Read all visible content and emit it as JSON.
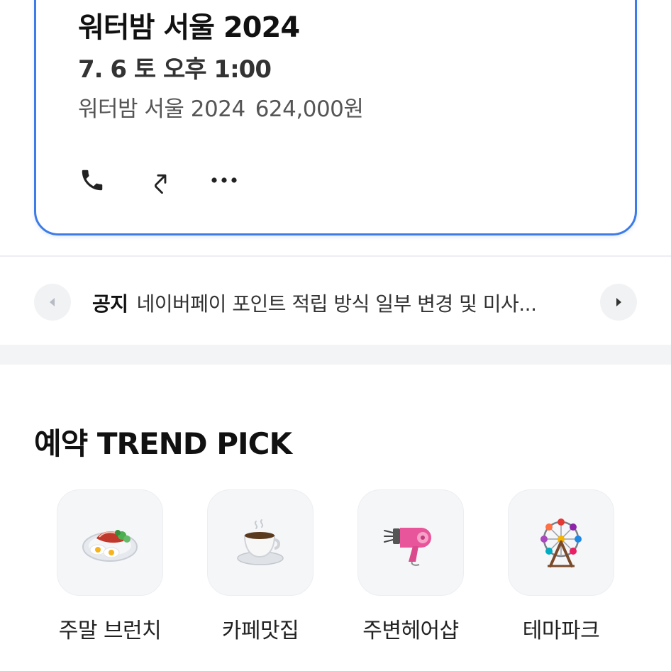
{
  "booking": {
    "title": "워터밤 서울 2024",
    "datetime": "7. 6 토 오후 1:00",
    "item_name": "워터밤 서울 2024",
    "price": "624,000원",
    "actions": [
      "phone-icon",
      "share-icon",
      "more-icon"
    ],
    "accent_color": "#3d7be6"
  },
  "notice": {
    "tag": "공지",
    "text": "네이버페이 포인트 적립 방식 일부 변경 및 미사..."
  },
  "trend": {
    "title": "예약 TREND PICK",
    "items": [
      {
        "label": "주말 브런치",
        "icon": "brunch-plate-icon"
      },
      {
        "label": "카페맛집",
        "icon": "coffee-cup-icon"
      },
      {
        "label": "주변헤어샵",
        "icon": "hair-dryer-icon"
      },
      {
        "label": "테마파크",
        "icon": "ferris-wheel-icon"
      }
    ]
  }
}
